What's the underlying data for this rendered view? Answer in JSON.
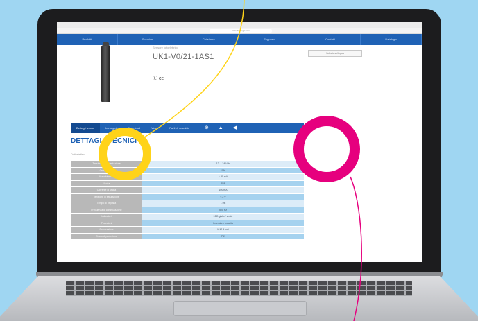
{
  "browser": {
    "url": "www.datalogic.com"
  },
  "site": {
    "nav": [
      "Prodotti",
      "Soluzioni",
      "Chi siamo",
      "Supporto",
      "Contatti",
      "Datalogic"
    ],
    "language_button": "Seleziona lingua"
  },
  "product": {
    "subtitle": "Sensore fotoelettrico",
    "title": "UK1-V0/21-1AS1",
    "certifications": "Ⓛ ᴄᴇ"
  },
  "tabs": {
    "items": [
      "Dettagli tecnici",
      "Immagini",
      "Download",
      "Video",
      "Parti di ricambio"
    ],
    "tool_icons": [
      "globe-icon",
      "user-icon",
      "share-icon"
    ]
  },
  "section": {
    "title": "DETTAGLI TECNICI",
    "subtitle": "Dati elettrici"
  },
  "specs": [
    {
      "key": "Tensione di alimentazione",
      "value": "12 ... 24 Vdc"
    },
    {
      "key": "Ondulazione",
      "value": "10%"
    },
    {
      "key": "Assorbimento",
      "value": "< 30 mA"
    },
    {
      "key": "Uscita",
      "value": "PNP"
    },
    {
      "key": "Corrente di uscita",
      "value": "100 mA"
    },
    {
      "key": "Tensione di saturazione",
      "value": "< 2 V"
    },
    {
      "key": "Tempo di risposta",
      "value": "1 ms"
    },
    {
      "key": "Frequenza di commutazione",
      "value": "500 Hz"
    },
    {
      "key": "Indicatori",
      "value": "LED giallo / verde"
    },
    {
      "key": "Protezioni",
      "value": "Inversione polarità"
    },
    {
      "key": "Connessione",
      "value": "M12 4 poli"
    },
    {
      "key": "Grado di protezione",
      "value": "IP67"
    }
  ],
  "colors": {
    "brand_blue": "#1f62b5",
    "ring_yellow": "#ffd319",
    "ring_pink": "#e6007e",
    "background": "#9fd6f2"
  }
}
